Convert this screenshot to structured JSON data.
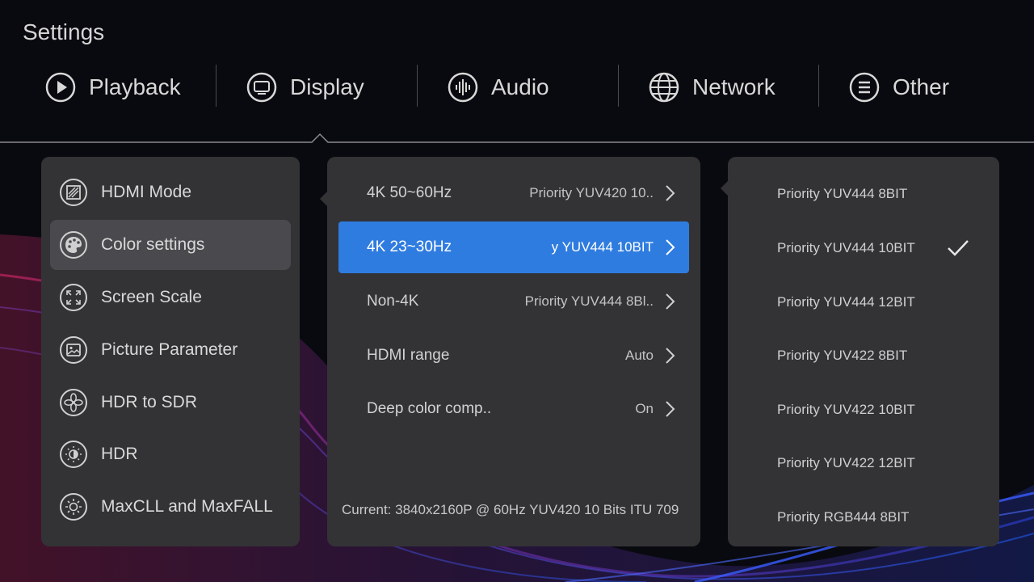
{
  "window": {
    "title": "Settings"
  },
  "tabs": [
    {
      "label": "Playback",
      "icon": "play-circle-icon"
    },
    {
      "label": "Display",
      "icon": "monitor-icon",
      "selected": true
    },
    {
      "label": "Audio",
      "icon": "audio-wave-icon"
    },
    {
      "label": "Network",
      "icon": "globe-icon"
    },
    {
      "label": "Other",
      "icon": "menu-circle-icon"
    }
  ],
  "left_menu": [
    {
      "label": "HDMI Mode",
      "icon": "hdmi-mode-icon"
    },
    {
      "label": "Color settings",
      "icon": "palette-icon",
      "selected": true
    },
    {
      "label": "Screen Scale",
      "icon": "expand-arrows-icon"
    },
    {
      "label": "Picture Parameter",
      "icon": "picture-icon"
    },
    {
      "label": "HDR to SDR",
      "icon": "flower-icon"
    },
    {
      "label": "HDR",
      "icon": "hdr-sun-icon"
    },
    {
      "label": "MaxCLL and MaxFALL",
      "icon": "brightness-icon"
    }
  ],
  "color_settings": [
    {
      "label": "4K 50~60Hz",
      "value": "Priority YUV420 10.."
    },
    {
      "label": "4K 23~30Hz",
      "value": "y YUV444 10BIT",
      "selected": true
    },
    {
      "label": "Non-4K",
      "value": "Priority YUV444 8Bl.."
    },
    {
      "label": "HDMI range",
      "value": "Auto"
    },
    {
      "label": "Deep color comp..",
      "value": "On"
    }
  ],
  "current_info": "Current: 3840x2160P @ 60Hz  YUV420  10 Bits  ITU 709",
  "options": [
    {
      "label": "Priority YUV444 8BIT"
    },
    {
      "label": "Priority YUV444 10BIT",
      "checked": true
    },
    {
      "label": "Priority YUV444 12BIT"
    },
    {
      "label": "Priority YUV422 8BIT"
    },
    {
      "label": "Priority YUV422 10BIT"
    },
    {
      "label": "Priority YUV422 12BIT"
    },
    {
      "label": "Priority RGB444 8BIT"
    }
  ],
  "colors": {
    "background": "#090a0f",
    "panel": "#333336",
    "selected_row": "#2f7ce0",
    "selected_menu": "#4a4a4e",
    "text": "#d9d9d9"
  }
}
